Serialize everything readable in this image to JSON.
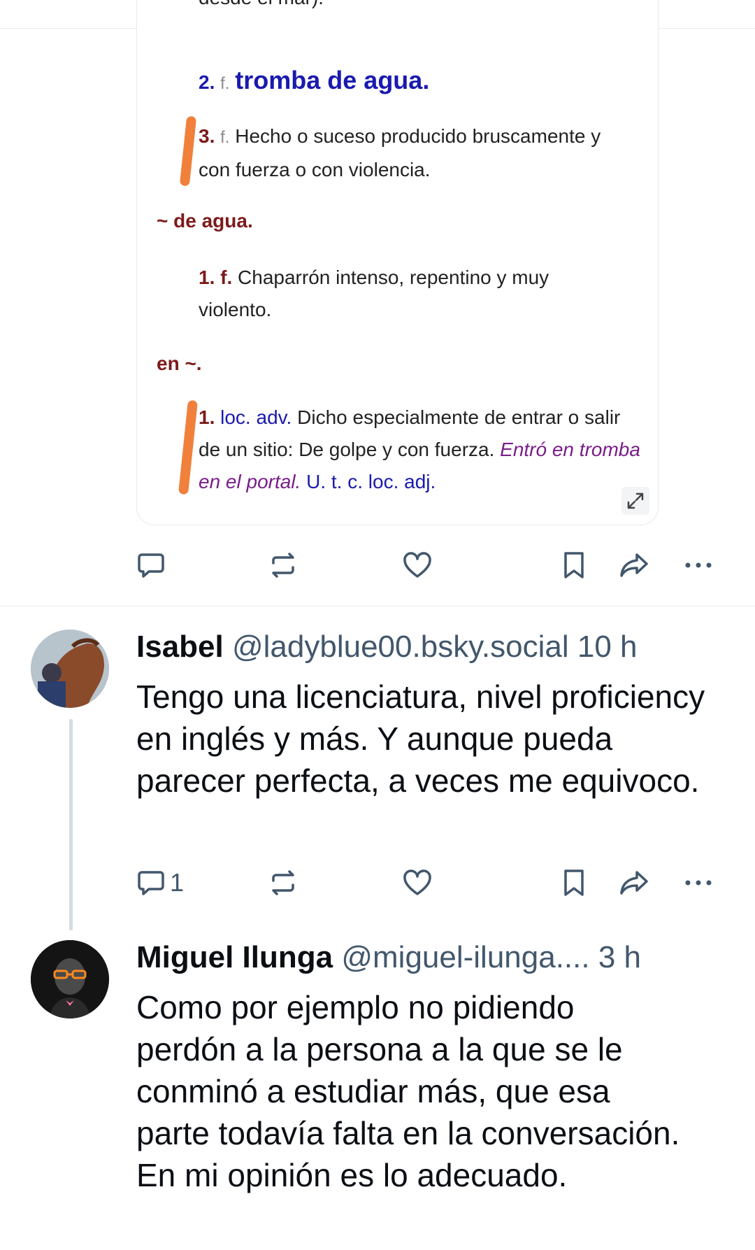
{
  "embed": {
    "cut_text": "desde el mar).",
    "senses": [
      {
        "num": "2.",
        "gram": "f.",
        "text": "tromba de agua."
      },
      {
        "num": "3.",
        "gram": "f.",
        "text": "Hecho o suceso producido bruscamente y con fuerza o con violencia."
      }
    ],
    "sub1": {
      "title": "~ de agua.",
      "num": "1.",
      "gram": "f.",
      "text": "Chaparrón intenso, repentino y muy violento."
    },
    "sub2": {
      "title": "en ~.",
      "num": "1.",
      "gram": "loc. adv.",
      "text": "Dicho especialmente de entrar o salir de un sitio: De golpe y con fuerza.",
      "example": "Entró en tromba en el portal.",
      "note": "U. t. c. loc. adj."
    }
  },
  "colors": {
    "accent_orange": "#f0803c",
    "icon_gray": "#42576c",
    "dict_red": "#7d1a1a",
    "dict_blue": "#1a1ab0"
  },
  "posts": [
    {
      "author": "Isabel",
      "handle": "@ladyblue00.bsky.social",
      "time": "10 h",
      "text": "Tengo una licenciatura, nivel proficiency en inglés y más. Y aunque pueda parecer perfecta, a veces me equivoco.",
      "reply_count": "1"
    },
    {
      "author": "Miguel Ilunga",
      "handle": "@miguel-ilunga....",
      "time": "3 h",
      "text": "Como por ejemplo no pidiendo perdón a la persona a la que se le conminó a estudiar más, que esa parte todavía falta en la conversación. En mi opinión es lo adecuado."
    }
  ],
  "icons": [
    "reply-icon",
    "repost-icon",
    "like-icon",
    "bookmark-icon",
    "share-icon",
    "more-icon",
    "expand-icon"
  ]
}
